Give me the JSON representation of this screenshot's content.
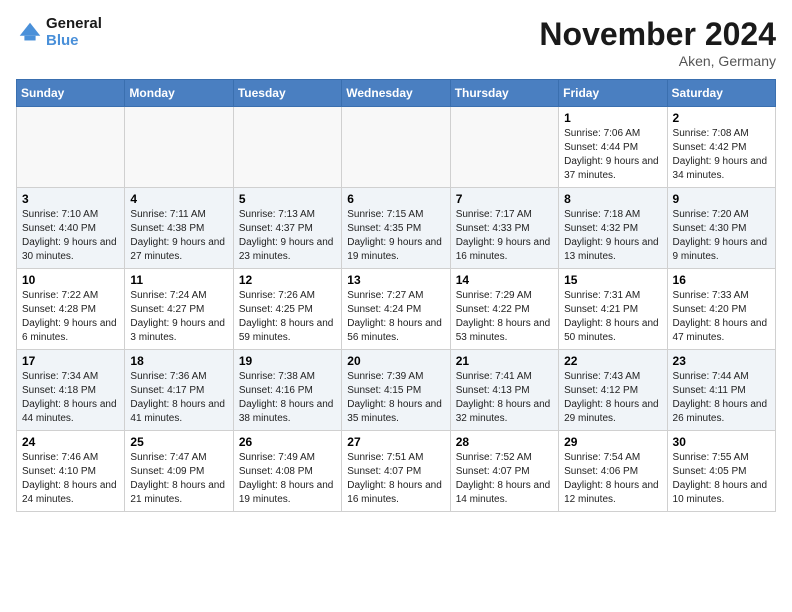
{
  "header": {
    "logo_line1": "General",
    "logo_line2": "Blue",
    "month_title": "November 2024",
    "location": "Aken, Germany"
  },
  "days_of_week": [
    "Sunday",
    "Monday",
    "Tuesday",
    "Wednesday",
    "Thursday",
    "Friday",
    "Saturday"
  ],
  "weeks": [
    [
      {
        "num": "",
        "sunrise": "",
        "sunset": "",
        "daylight": ""
      },
      {
        "num": "",
        "sunrise": "",
        "sunset": "",
        "daylight": ""
      },
      {
        "num": "",
        "sunrise": "",
        "sunset": "",
        "daylight": ""
      },
      {
        "num": "",
        "sunrise": "",
        "sunset": "",
        "daylight": ""
      },
      {
        "num": "",
        "sunrise": "",
        "sunset": "",
        "daylight": ""
      },
      {
        "num": "1",
        "sunrise": "Sunrise: 7:06 AM",
        "sunset": "Sunset: 4:44 PM",
        "daylight": "Daylight: 9 hours and 37 minutes."
      },
      {
        "num": "2",
        "sunrise": "Sunrise: 7:08 AM",
        "sunset": "Sunset: 4:42 PM",
        "daylight": "Daylight: 9 hours and 34 minutes."
      }
    ],
    [
      {
        "num": "3",
        "sunrise": "Sunrise: 7:10 AM",
        "sunset": "Sunset: 4:40 PM",
        "daylight": "Daylight: 9 hours and 30 minutes."
      },
      {
        "num": "4",
        "sunrise": "Sunrise: 7:11 AM",
        "sunset": "Sunset: 4:38 PM",
        "daylight": "Daylight: 9 hours and 27 minutes."
      },
      {
        "num": "5",
        "sunrise": "Sunrise: 7:13 AM",
        "sunset": "Sunset: 4:37 PM",
        "daylight": "Daylight: 9 hours and 23 minutes."
      },
      {
        "num": "6",
        "sunrise": "Sunrise: 7:15 AM",
        "sunset": "Sunset: 4:35 PM",
        "daylight": "Daylight: 9 hours and 19 minutes."
      },
      {
        "num": "7",
        "sunrise": "Sunrise: 7:17 AM",
        "sunset": "Sunset: 4:33 PM",
        "daylight": "Daylight: 9 hours and 16 minutes."
      },
      {
        "num": "8",
        "sunrise": "Sunrise: 7:18 AM",
        "sunset": "Sunset: 4:32 PM",
        "daylight": "Daylight: 9 hours and 13 minutes."
      },
      {
        "num": "9",
        "sunrise": "Sunrise: 7:20 AM",
        "sunset": "Sunset: 4:30 PM",
        "daylight": "Daylight: 9 hours and 9 minutes."
      }
    ],
    [
      {
        "num": "10",
        "sunrise": "Sunrise: 7:22 AM",
        "sunset": "Sunset: 4:28 PM",
        "daylight": "Daylight: 9 hours and 6 minutes."
      },
      {
        "num": "11",
        "sunrise": "Sunrise: 7:24 AM",
        "sunset": "Sunset: 4:27 PM",
        "daylight": "Daylight: 9 hours and 3 minutes."
      },
      {
        "num": "12",
        "sunrise": "Sunrise: 7:26 AM",
        "sunset": "Sunset: 4:25 PM",
        "daylight": "Daylight: 8 hours and 59 minutes."
      },
      {
        "num": "13",
        "sunrise": "Sunrise: 7:27 AM",
        "sunset": "Sunset: 4:24 PM",
        "daylight": "Daylight: 8 hours and 56 minutes."
      },
      {
        "num": "14",
        "sunrise": "Sunrise: 7:29 AM",
        "sunset": "Sunset: 4:22 PM",
        "daylight": "Daylight: 8 hours and 53 minutes."
      },
      {
        "num": "15",
        "sunrise": "Sunrise: 7:31 AM",
        "sunset": "Sunset: 4:21 PM",
        "daylight": "Daylight: 8 hours and 50 minutes."
      },
      {
        "num": "16",
        "sunrise": "Sunrise: 7:33 AM",
        "sunset": "Sunset: 4:20 PM",
        "daylight": "Daylight: 8 hours and 47 minutes."
      }
    ],
    [
      {
        "num": "17",
        "sunrise": "Sunrise: 7:34 AM",
        "sunset": "Sunset: 4:18 PM",
        "daylight": "Daylight: 8 hours and 44 minutes."
      },
      {
        "num": "18",
        "sunrise": "Sunrise: 7:36 AM",
        "sunset": "Sunset: 4:17 PM",
        "daylight": "Daylight: 8 hours and 41 minutes."
      },
      {
        "num": "19",
        "sunrise": "Sunrise: 7:38 AM",
        "sunset": "Sunset: 4:16 PM",
        "daylight": "Daylight: 8 hours and 38 minutes."
      },
      {
        "num": "20",
        "sunrise": "Sunrise: 7:39 AM",
        "sunset": "Sunset: 4:15 PM",
        "daylight": "Daylight: 8 hours and 35 minutes."
      },
      {
        "num": "21",
        "sunrise": "Sunrise: 7:41 AM",
        "sunset": "Sunset: 4:13 PM",
        "daylight": "Daylight: 8 hours and 32 minutes."
      },
      {
        "num": "22",
        "sunrise": "Sunrise: 7:43 AM",
        "sunset": "Sunset: 4:12 PM",
        "daylight": "Daylight: 8 hours and 29 minutes."
      },
      {
        "num": "23",
        "sunrise": "Sunrise: 7:44 AM",
        "sunset": "Sunset: 4:11 PM",
        "daylight": "Daylight: 8 hours and 26 minutes."
      }
    ],
    [
      {
        "num": "24",
        "sunrise": "Sunrise: 7:46 AM",
        "sunset": "Sunset: 4:10 PM",
        "daylight": "Daylight: 8 hours and 24 minutes."
      },
      {
        "num": "25",
        "sunrise": "Sunrise: 7:47 AM",
        "sunset": "Sunset: 4:09 PM",
        "daylight": "Daylight: 8 hours and 21 minutes."
      },
      {
        "num": "26",
        "sunrise": "Sunrise: 7:49 AM",
        "sunset": "Sunset: 4:08 PM",
        "daylight": "Daylight: 8 hours and 19 minutes."
      },
      {
        "num": "27",
        "sunrise": "Sunrise: 7:51 AM",
        "sunset": "Sunset: 4:07 PM",
        "daylight": "Daylight: 8 hours and 16 minutes."
      },
      {
        "num": "28",
        "sunrise": "Sunrise: 7:52 AM",
        "sunset": "Sunset: 4:07 PM",
        "daylight": "Daylight: 8 hours and 14 minutes."
      },
      {
        "num": "29",
        "sunrise": "Sunrise: 7:54 AM",
        "sunset": "Sunset: 4:06 PM",
        "daylight": "Daylight: 8 hours and 12 minutes."
      },
      {
        "num": "30",
        "sunrise": "Sunrise: 7:55 AM",
        "sunset": "Sunset: 4:05 PM",
        "daylight": "Daylight: 8 hours and 10 minutes."
      }
    ]
  ]
}
